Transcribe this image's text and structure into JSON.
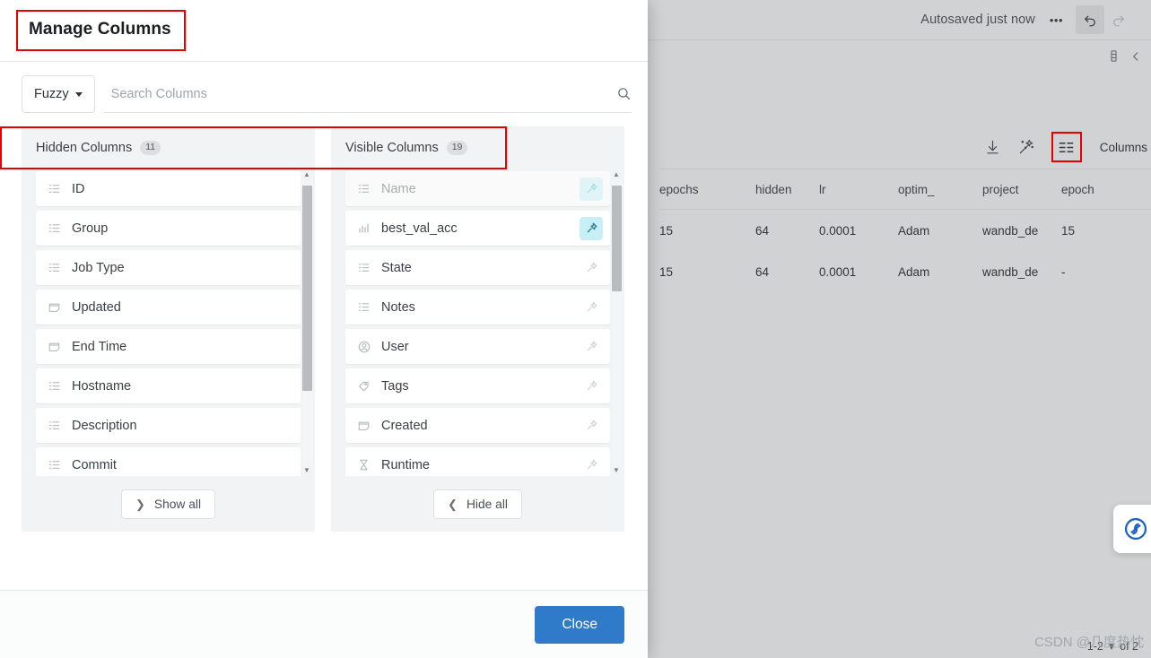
{
  "background": {
    "autosave_status": "Autosaved just now",
    "more_label": "•••",
    "undo_icon": "undo-icon",
    "redo_icon": "redo-icon",
    "panel_icon": "side-panel-icon",
    "collapse_icon": "chevron-left-icon",
    "toolbar": {
      "download_icon": "download-icon",
      "magic_icon": "magic-wand-icon",
      "columns_icon": "columns-icon",
      "columns_label": "Columns"
    },
    "table": {
      "headers": [
        "epochs",
        "hidden",
        "lr",
        "optim_",
        "project",
        "epoch"
      ],
      "rows": [
        [
          "15",
          "64",
          "0.0001",
          "Adam",
          "wandb_de",
          "15"
        ],
        [
          "15",
          "64",
          "0.0001",
          "Adam",
          "wandb_de",
          "-"
        ]
      ]
    },
    "paginator": {
      "range": "1-2",
      "of": "of 2",
      "caret": "▾"
    },
    "watermark": "CSDN @几度热忱"
  },
  "modal": {
    "title": "Manage Columns",
    "search": {
      "mode_label": "Fuzzy",
      "placeholder": "Search Columns",
      "value": "",
      "search_icon": "search-icon"
    },
    "panels": [
      {
        "key": "hidden",
        "title": "Hidden Columns",
        "count": "11",
        "action_label": "Show all",
        "action_icon": "chevron-right-icon",
        "scroll_thumb_top_pct": 2,
        "scroll_thumb_height_pct": 72,
        "items": [
          {
            "label": "ID",
            "icon": "list-icon",
            "muted": false,
            "pin": "none"
          },
          {
            "label": "Group",
            "icon": "list-icon",
            "muted": false,
            "pin": "none"
          },
          {
            "label": "Job Type",
            "icon": "list-icon",
            "muted": false,
            "pin": "none"
          },
          {
            "label": "Updated",
            "icon": "calendar-icon",
            "muted": false,
            "pin": "none"
          },
          {
            "label": "End Time",
            "icon": "calendar-icon",
            "muted": false,
            "pin": "none"
          },
          {
            "label": "Hostname",
            "icon": "list-icon",
            "muted": false,
            "pin": "none"
          },
          {
            "label": "Description",
            "icon": "list-icon",
            "muted": false,
            "pin": "none"
          },
          {
            "label": "Commit",
            "icon": "list-icon",
            "muted": false,
            "pin": "none"
          }
        ]
      },
      {
        "key": "visible",
        "title": "Visible Columns",
        "count": "19",
        "action_label": "Hide all",
        "action_icon": "chevron-left-icon",
        "scroll_thumb_top_pct": 2,
        "scroll_thumb_height_pct": 37,
        "items": [
          {
            "label": "Name",
            "icon": "list-icon",
            "muted": true,
            "pin": "pinned-soft"
          },
          {
            "label": "best_val_acc",
            "icon": "bar-chart-icon",
            "muted": false,
            "pin": "pinned"
          },
          {
            "label": "State",
            "icon": "list-icon",
            "muted": false,
            "pin": "unpinned"
          },
          {
            "label": "Notes",
            "icon": "list-icon",
            "muted": false,
            "pin": "unpinned"
          },
          {
            "label": "User",
            "icon": "user-icon",
            "muted": false,
            "pin": "unpinned"
          },
          {
            "label": "Tags",
            "icon": "tag-icon",
            "muted": false,
            "pin": "unpinned"
          },
          {
            "label": "Created",
            "icon": "calendar-icon",
            "muted": false,
            "pin": "unpinned"
          },
          {
            "label": "Runtime",
            "icon": "hourglass-icon",
            "muted": false,
            "pin": "unpinned"
          }
        ]
      }
    ],
    "close_label": "Close"
  },
  "colors": {
    "accent": "#2f7ac9",
    "highlight_box": "#e60000",
    "pin_active": "#2a7f91",
    "pin_active_bg": "#c8eff5"
  }
}
